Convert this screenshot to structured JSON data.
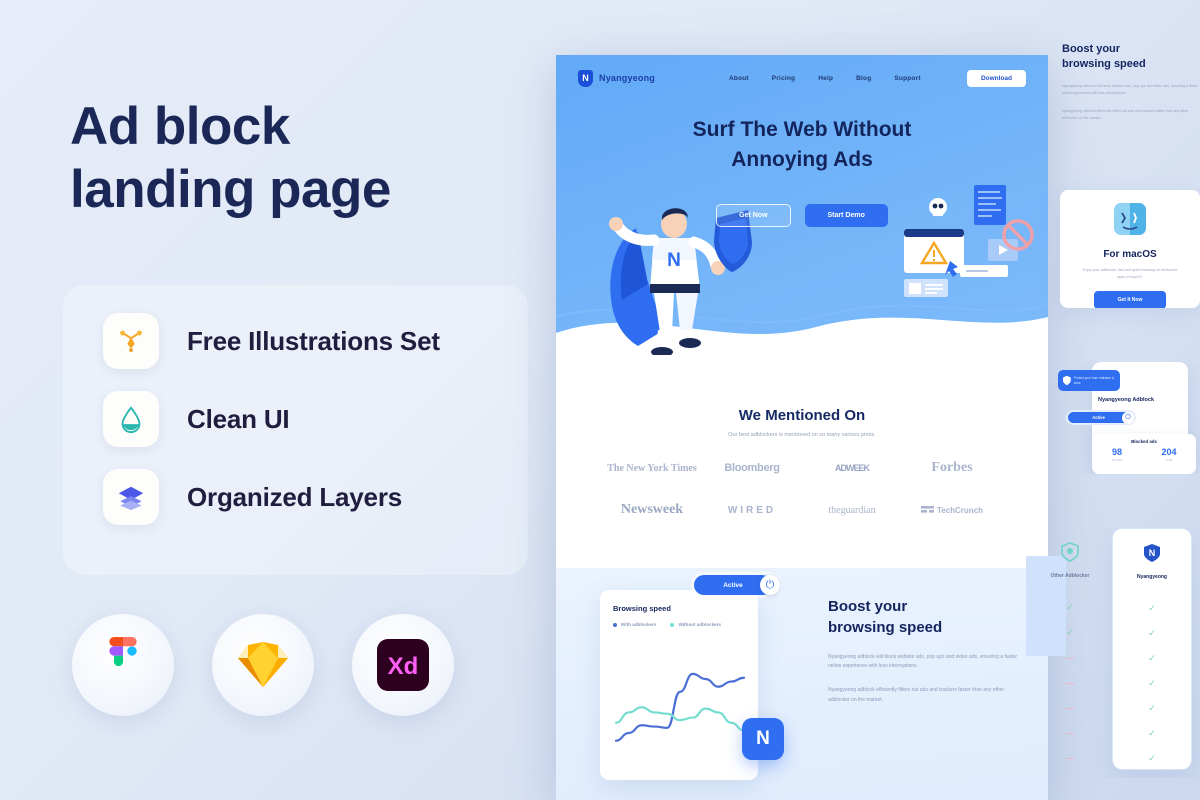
{
  "promo": {
    "title_line1": "Ad block",
    "title_line2": "landing page",
    "features": [
      {
        "label": "Free Illustrations Set",
        "icon": "pen-tool-icon",
        "color": "#f5a623"
      },
      {
        "label": "Clean UI",
        "icon": "water-drop-icon",
        "color": "#2ab7b0"
      },
      {
        "label": "Organized Layers",
        "icon": "layers-icon",
        "color": "#5b5be0"
      }
    ],
    "apps": [
      {
        "name": "Figma",
        "icon": "figma-icon"
      },
      {
        "name": "Sketch",
        "icon": "sketch-icon"
      },
      {
        "name": "Adobe XD",
        "icon": "adobe-xd-icon"
      }
    ]
  },
  "mockup": {
    "brand": {
      "name": "Nyangyeong",
      "mark": "N"
    },
    "nav": {
      "links": [
        "About",
        "Pricing",
        "Help",
        "Blog",
        "Support"
      ],
      "cta": "Download"
    },
    "hero": {
      "headline_line1": "Surf The Web Without",
      "headline_line2": "Annoying Ads",
      "btn_ghost": "Get Now",
      "btn_solid": "Start Demo"
    },
    "mention": {
      "heading": "We Mentioned On",
      "subtitle": "Our best adblockers is mentioned on so many various press.",
      "logos": [
        "The New York Times",
        "Bloomberg",
        "ADWEEK",
        "Forbes",
        "Newsweek",
        "WIRED",
        "theguardian",
        "TechCrunch"
      ]
    },
    "boost": {
      "heading_line1": "Boost your",
      "heading_line2": "browsing speed",
      "paragraph1": "Nyangyeong adblock will block website ads, pop ups and video ads, ensuring a faster online experience with less interruptions.",
      "paragraph2": "Nyangyeong adblock efficiently filters out ads and trackers faster than any other adblocker on the market.",
      "chart_card_title": "Browsing speed",
      "legend_with": "With adblockers",
      "legend_without": "Without adblockers",
      "toggle_label": "Active",
      "logo_mark": "N"
    }
  },
  "right_stack": {
    "boost": {
      "heading_line1": "Boost your",
      "heading_line2": "browsing speed",
      "paragraph1": "Nyangyeong adblock will block website ads, pop ups and video ads, ensuring a faster online experience with less interruptions.",
      "paragraph2": "Nyangyeong adblock efficiently filters out ads and trackers faster than any other adblocker on the market."
    },
    "macos": {
      "icon": "finder-icon",
      "heading": "For macOS",
      "paragraph": "Enjoy your adblocker, fast and quiet browsing on all favorite apps of macOS.",
      "button": "Get It Now"
    },
    "widget": {
      "tooltip": "Protect your from malware & virus",
      "logo_mark": "N",
      "name": "Nyangyeong Adblock",
      "toggle_label": "Active",
      "stats_label": "Blocked ads",
      "stat1_value": "98",
      "stat1_caption": "This Site",
      "stat2_value": "204",
      "stat2_caption": "Total"
    },
    "compare": {
      "left_name": "Other Adblocker",
      "right_name": "Nyangyeong",
      "left_marks": [
        "check",
        "check",
        "dash",
        "dash",
        "dash",
        "dash",
        "dash"
      ],
      "right_marks": [
        "check",
        "check",
        "check",
        "check",
        "check",
        "check",
        "check"
      ]
    }
  },
  "chart_data": {
    "type": "line",
    "title": "Browsing speed",
    "xlabel": "",
    "ylabel": "",
    "x": [
      0,
      1,
      2,
      3,
      4,
      5,
      6,
      7,
      8,
      9,
      10
    ],
    "series": [
      {
        "name": "With adblockers",
        "color": "#4a6fd6",
        "values": [
          8,
          14,
          20,
          19,
          18,
          46,
          60,
          56,
          50,
          54,
          57
        ]
      },
      {
        "name": "Without adblockers",
        "color": "#74ddd0",
        "values": [
          22,
          30,
          34,
          30,
          29,
          24,
          26,
          33,
          30,
          22,
          16
        ]
      }
    ],
    "ylim": [
      0,
      70
    ],
    "grid": false,
    "legend_position": "top-left"
  }
}
